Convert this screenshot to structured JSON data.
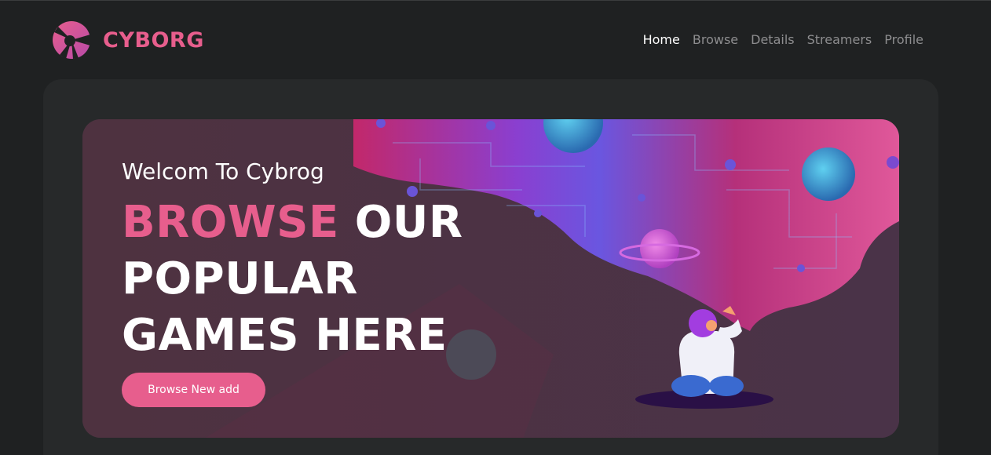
{
  "header": {
    "brand": "CYBORG",
    "nav": {
      "home": "Home",
      "browse": "Browse",
      "details": "Details",
      "streamers": "Streamers",
      "profile": "Profile"
    }
  },
  "banner": {
    "welcome": "Welcom To Cybrog",
    "headline_highlight": "BROWSE",
    "headline_rest_line1": " OUR",
    "headline_line2": "POPULAR",
    "headline_line3": "GAMES HERE",
    "cta_label": "Browse New add"
  },
  "colors": {
    "accent": "#e75e8d",
    "background": "#1f2122",
    "panel": "#27292a"
  }
}
